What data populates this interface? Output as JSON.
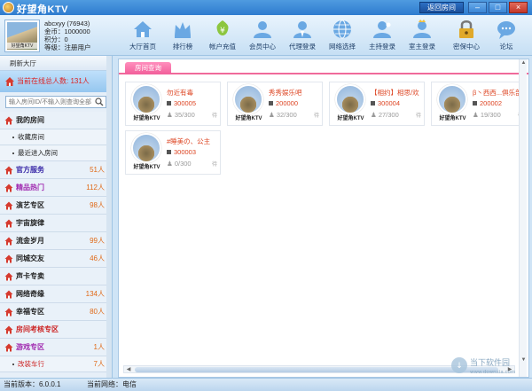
{
  "window": {
    "title": "好望角KTV",
    "return_room_label": "返回房间",
    "min_glyph": "–",
    "max_glyph": "□",
    "close_glyph": "×"
  },
  "user": {
    "name_line": "abcxyy (76943)",
    "gold_line": "金币：1000000",
    "points_line": "积分：0",
    "level_line": "等级：注册用户",
    "avatar_caption": "好望角KTV"
  },
  "toolbar": {
    "items": [
      {
        "label": "大厅首页",
        "icon": "home-icon",
        "color": "#6aa8e3"
      },
      {
        "label": "排行榜",
        "icon": "crown-icon",
        "color": "#6aa8e3"
      },
      {
        "label": "帐户充值",
        "icon": "yuan-icon",
        "color": "#8cc63f"
      },
      {
        "label": "会员中心",
        "icon": "member-icon",
        "color": "#6aa8e3"
      },
      {
        "label": "代理登录",
        "icon": "agent-icon",
        "color": "#6aa8e3"
      },
      {
        "label": "网络选择",
        "icon": "globe-icon",
        "color": "#6aa8e3"
      },
      {
        "label": "主持登录",
        "icon": "host-icon",
        "color": "#6aa8e3"
      },
      {
        "label": "室主登录",
        "icon": "owner-icon",
        "color": "#6aa8e3"
      },
      {
        "label": "密保中心",
        "icon": "lock-icon",
        "color": "#e0a92a"
      },
      {
        "label": "论坛",
        "icon": "chat-icon",
        "color": "#6aa8e3"
      }
    ]
  },
  "sidebar": {
    "refresh_label": "刷新大厅",
    "online_text": "当前在线总人数: 131人",
    "search_placeholder": "输入房间ID/不输入则查询全部",
    "rows": [
      {
        "label": "我的房间",
        "count": "",
        "type": "main"
      },
      {
        "label": "收藏房间",
        "count": "",
        "type": "sub"
      },
      {
        "label": "最近进入房间",
        "count": "",
        "type": "sub"
      },
      {
        "label": "官方服务",
        "count": "51人",
        "type": "main",
        "color": "#3a2aa8"
      },
      {
        "label": "精品热门",
        "count": "112人",
        "type": "main",
        "color": "#a02ab0"
      },
      {
        "label": "演艺专区",
        "count": "98人",
        "type": "main"
      },
      {
        "label": "宇宙旋律",
        "count": "",
        "type": "main"
      },
      {
        "label": "流金岁月",
        "count": "99人",
        "type": "main"
      },
      {
        "label": "同城交友",
        "count": "46人",
        "type": "main"
      },
      {
        "label": "声卡专卖",
        "count": "",
        "type": "main"
      },
      {
        "label": "网络奇缘",
        "count": "134人",
        "type": "main"
      },
      {
        "label": "幸福专区",
        "count": "80人",
        "type": "main"
      },
      {
        "label": "房间考核专区",
        "count": "",
        "type": "main",
        "color": "#c22"
      },
      {
        "label": "游戏专区",
        "count": "1人",
        "type": "main",
        "color": "#a02ab0"
      },
      {
        "label": "改装车行",
        "count": "7人",
        "type": "sub",
        "color": "#c22"
      }
    ]
  },
  "content": {
    "tab_label": "房间查询",
    "rooms": [
      {
        "name": "勿近有毒",
        "id": "300005",
        "count": "35/300",
        "caption": "好望角KTV",
        "lock": "待"
      },
      {
        "name": "秀秀娱乐吧",
        "id": "200000",
        "count": "32/300",
        "caption": "好望角KTV",
        "lock": "待"
      },
      {
        "name": "【相约】相思/欢",
        "id": "300004",
        "count": "27/300",
        "caption": "好望角KTV",
        "lock": "待"
      },
      {
        "name": "β丶西西...俱乐部",
        "id": "200002",
        "count": "19/300",
        "caption": "好望角KTV",
        "lock": "待"
      },
      {
        "name": "#睡美の、公主",
        "id": "300003",
        "count": "0/300",
        "caption": "好望角KTV",
        "lock": "待"
      }
    ]
  },
  "status": {
    "version": "当前版本：6.0.0.1",
    "network": "当前网络：电信"
  },
  "watermark": {
    "main": "当下软件园",
    "url": "www.downxia.com"
  }
}
